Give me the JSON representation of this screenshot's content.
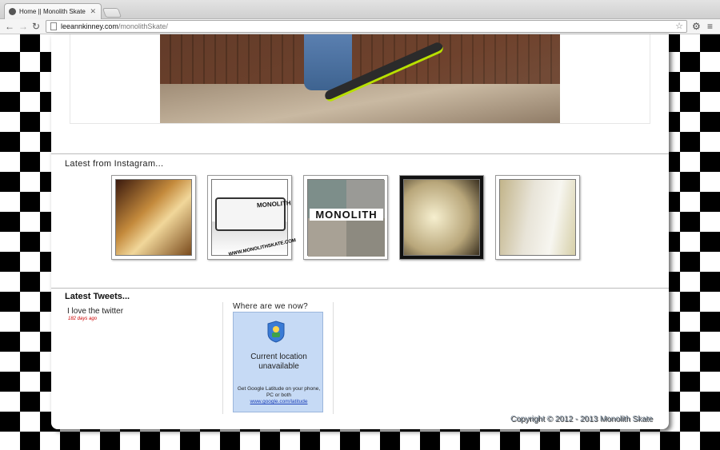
{
  "browser": {
    "tab_title": "Home || Monolith Skate",
    "url_domain": "leeannkinney.com",
    "url_path": "/monolithSkate/"
  },
  "hero": {
    "alt": "skateboarder on ramp"
  },
  "instagram": {
    "title": "Latest from Instagram...",
    "thumbs": [
      {
        "id": "boxes"
      },
      {
        "id": "truck-logo",
        "logo": "MONOLITH",
        "url": "WWW.MONOLITHSKATE.COM"
      },
      {
        "id": "collage",
        "logo": "MONOLITH"
      },
      {
        "id": "van-dark"
      },
      {
        "id": "van-inside"
      }
    ]
  },
  "tweets": {
    "title": "Latest Tweets...",
    "items": [
      {
        "text": "I love the twitter",
        "time": "182 days ago"
      }
    ]
  },
  "location": {
    "title": "Where are we now?",
    "main": "Current location unavailable",
    "sub": "Get Google Latitude on your phone, PC or both",
    "link": "www.google.com/latitude"
  },
  "footer": {
    "copyright": "Copyright © 2012 - 2013 Monolith Skate"
  },
  "colors": {
    "accent_time": "#cc0000",
    "latitude_bg": "#c6daf5"
  }
}
